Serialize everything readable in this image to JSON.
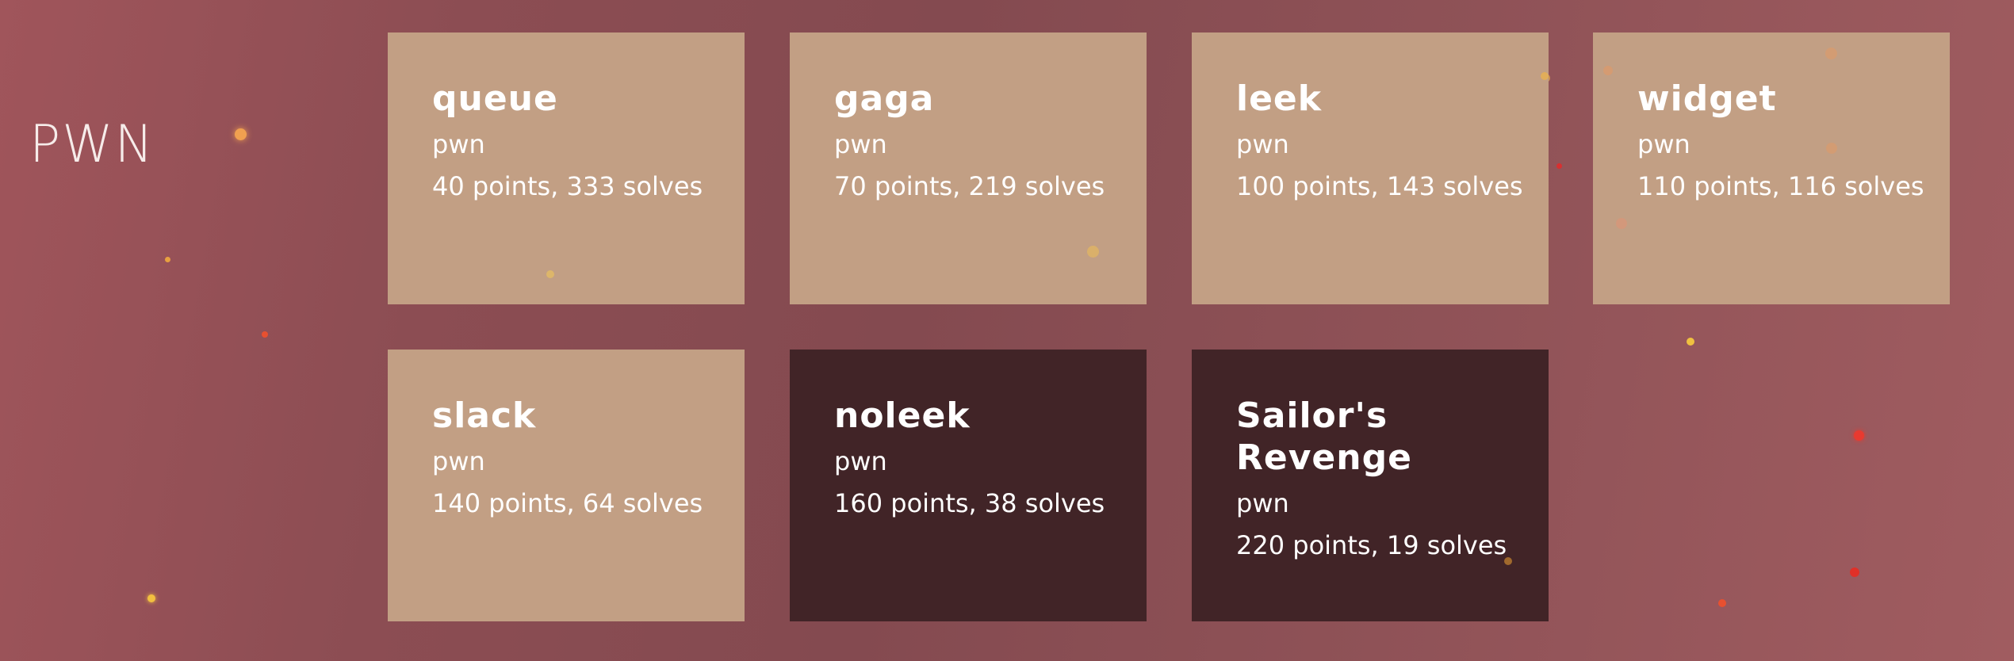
{
  "category": {
    "title": "PWN"
  },
  "colors": {
    "unsolved_card": "#c29f84",
    "solved_card": "#412427",
    "text": "#ffffff"
  },
  "challenges": [
    {
      "name": "queue",
      "category": "pwn",
      "stats": "40 points, 333 solves",
      "state": "unsolved"
    },
    {
      "name": "gaga",
      "category": "pwn",
      "stats": "70 points, 219 solves",
      "state": "unsolved"
    },
    {
      "name": "leek",
      "category": "pwn",
      "stats": "100 points, 143 solves",
      "state": "unsolved"
    },
    {
      "name": "widget",
      "category": "pwn",
      "stats": "110 points, 116 solves",
      "state": "unsolved"
    },
    {
      "name": "slack",
      "category": "pwn",
      "stats": "140 points, 64 solves",
      "state": "unsolved"
    },
    {
      "name": "noleek",
      "category": "pwn",
      "stats": "160 points, 38 solves",
      "state": "solved"
    },
    {
      "name": "Sailor's Revenge",
      "category": "pwn",
      "stats": "220 points, 19 solves",
      "state": "solved"
    }
  ]
}
